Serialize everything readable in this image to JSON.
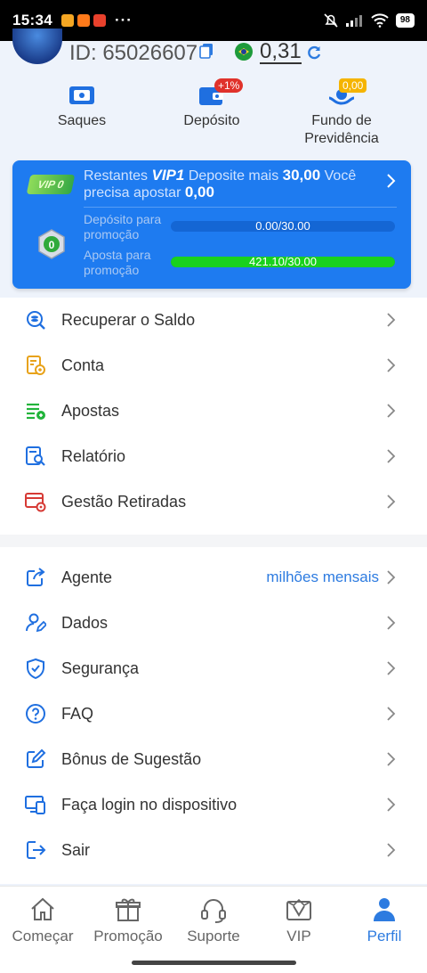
{
  "status_bar": {
    "time": "15:34",
    "battery": "98"
  },
  "header": {
    "user_id": "ID: 65026607",
    "balance": "0,31"
  },
  "quick_actions": [
    {
      "label": "Saques",
      "icon": "wallet-icon"
    },
    {
      "label": "Depósito",
      "icon": "deposit-icon",
      "badge": "+1%"
    },
    {
      "label": "Fundo de Previdência",
      "icon": "fund-icon",
      "badge": "0,00"
    }
  ],
  "vip": {
    "tag": "VIP 0",
    "line_prefix": "Restantes",
    "level": "VIP1",
    "line_mid": "Deposite mais",
    "deposit_needed": "30,00",
    "line_suffix": "Você precisa apostar",
    "bet_needed": "0,00",
    "medal_level": "0",
    "deposit_label": "Depósito para promoção",
    "deposit_progress": "0.00/30.00",
    "deposit_fraction": 0.0,
    "bet_label": "Aposta para promoção",
    "bet_progress": "421.10/30.00",
    "bet_fraction": 1.0
  },
  "menu_1": [
    {
      "label": "Recuperar o Saldo"
    },
    {
      "label": "Conta"
    },
    {
      "label": "Apostas"
    },
    {
      "label": "Relatório"
    },
    {
      "label": "Gestão Retiradas"
    }
  ],
  "menu_2": [
    {
      "label": "Agente",
      "extra": "milhões mensais"
    },
    {
      "label": "Dados"
    },
    {
      "label": "Segurança"
    },
    {
      "label": "FAQ"
    },
    {
      "label": "Bônus de Sugestão"
    },
    {
      "label": "Faça login no dispositivo"
    },
    {
      "label": "Sair"
    }
  ],
  "bottom_nav": [
    {
      "label": "Começar",
      "icon": "home-icon"
    },
    {
      "label": "Promoção",
      "icon": "gift-icon"
    },
    {
      "label": "Suporte",
      "icon": "headset-icon"
    },
    {
      "label": "VIP",
      "icon": "vip-crown-icon"
    },
    {
      "label": "Perfil",
      "icon": "profile-icon",
      "active": true
    }
  ],
  "colors": {
    "accent": "#2d7be0",
    "vip_card": "#1e7bf0",
    "progress_green": "#19d11d"
  }
}
